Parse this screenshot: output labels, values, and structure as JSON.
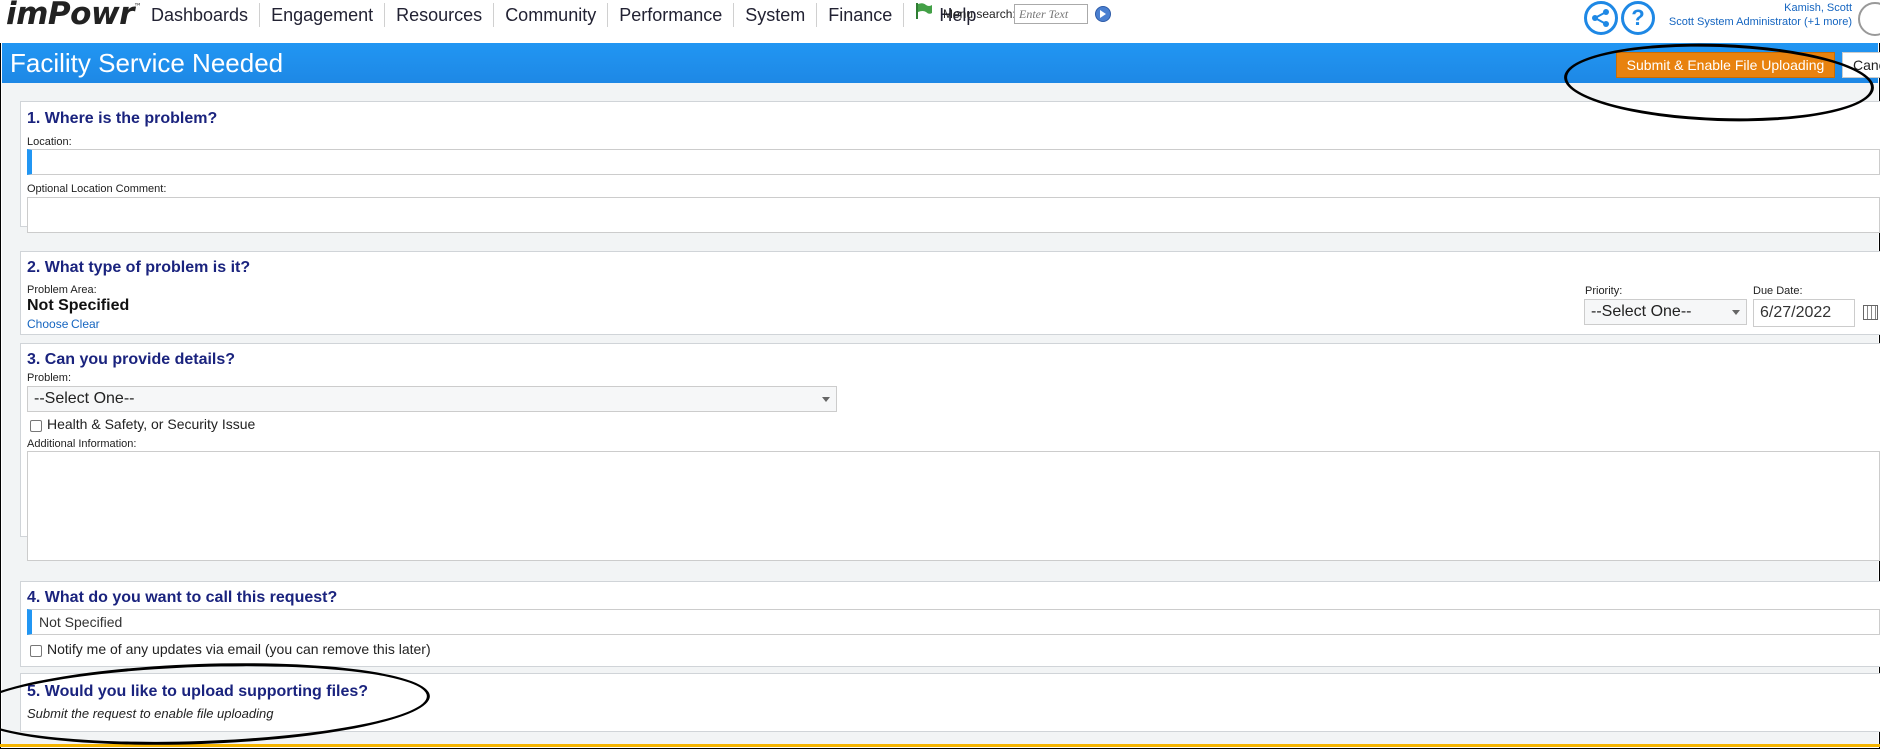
{
  "app": {
    "logo_text": "imPowr",
    "logo_mark": "™"
  },
  "nav": {
    "items": [
      "Dashboards",
      "Engagement",
      "Resources",
      "Community",
      "Performance",
      "System",
      "Finance"
    ],
    "help_label": "Help",
    "menu_search_label": "Menu search:",
    "menu_search_placeholder": "Enter Text"
  },
  "user": {
    "name": "Kamish, Scott",
    "role": "Scott System Administrator (+1 more)"
  },
  "header": {
    "title": "Facility Service Needed",
    "submit_label": "Submit & Enable File Uploading",
    "cancel_label": "Cancel"
  },
  "sections": {
    "s1": {
      "heading": "1. Where is the problem?",
      "location_label": "Location:",
      "comment_label": "Optional Location Comment:"
    },
    "s2": {
      "heading": "2. What type of problem is it?",
      "area_label": "Problem Area:",
      "area_value": "Not Specified",
      "choose_label": "Choose",
      "clear_label": "Clear",
      "priority_label": "Priority:",
      "priority_value": "--Select One--",
      "due_label": "Due Date:",
      "due_value": "6/27/2022"
    },
    "s3": {
      "heading": "3. Can you provide details?",
      "problem_label": "Problem:",
      "problem_value": "--Select One--",
      "health_label": "Health & Safety, or Security Issue",
      "additional_label": "Additional Information:"
    },
    "s4": {
      "heading": "4. What do you want to call this request?",
      "name_value": "Not Specified",
      "notify_label": "Notify me of any updates via email (you can remove this later)"
    },
    "s5": {
      "heading": "5. Would you like to upload supporting files?",
      "note": "Submit the request to enable file uploading"
    }
  },
  "colors": {
    "header_blue": "#1e88e5",
    "submit_orange": "#e8820e",
    "heading_navy": "#1a237e"
  }
}
